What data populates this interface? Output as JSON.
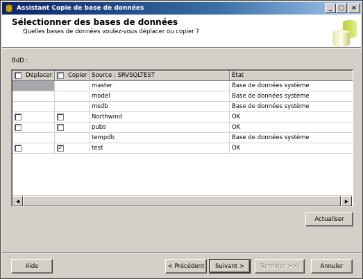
{
  "window": {
    "title": "Assistant Copie de base de données",
    "minimize_glyph": "_",
    "maximize_glyph": "□",
    "close_glyph": "×"
  },
  "header": {
    "title": "Sélectionner des bases de données",
    "subtitle": "Quelles bases de données voulez-vous déplacer ou copier ?"
  },
  "grid_label": "BdD :",
  "grid": {
    "headers": {
      "move": "Déplacer",
      "copy": "Copier",
      "source": "Source : SRVSQLTEST",
      "state": "État"
    },
    "rows": [
      {
        "name": "master",
        "state": "Base de données système",
        "has_move": false,
        "has_copy": false,
        "copy_checked": false
      },
      {
        "name": "model",
        "state": "Base de données système",
        "has_move": false,
        "has_copy": false,
        "copy_checked": false
      },
      {
        "name": "msdb",
        "state": "Base de données système",
        "has_move": false,
        "has_copy": false,
        "copy_checked": false
      },
      {
        "name": "Northwind",
        "state": "OK",
        "has_move": true,
        "has_copy": true,
        "copy_checked": false
      },
      {
        "name": "pubs",
        "state": "OK",
        "has_move": true,
        "has_copy": true,
        "copy_checked": false
      },
      {
        "name": "tempdb",
        "state": "Base de données système",
        "has_move": false,
        "has_copy": false,
        "copy_checked": false
      },
      {
        "name": "test",
        "state": "OK",
        "has_move": true,
        "has_copy": true,
        "copy_checked": true
      }
    ],
    "scroll_left": "◀",
    "scroll_right": "▶"
  },
  "buttons": {
    "refresh": "Actualiser",
    "help": "Aide",
    "back": "< Précédent",
    "next": "Suivant >",
    "finish": "Terminer >>|",
    "cancel": "Annuler"
  },
  "colors": {
    "titlebar_start": "#0a246a",
    "titlebar_end": "#a6caf0",
    "face": "#d4d0c8"
  }
}
